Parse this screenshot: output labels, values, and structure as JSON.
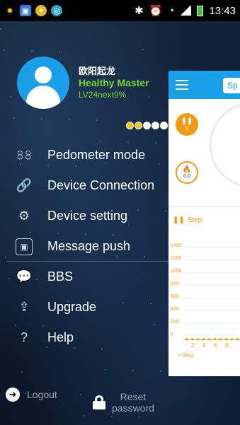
{
  "status_bar": {
    "time": "13:43",
    "icons": [
      "sun-icon",
      "app-icon",
      "chrome-icon",
      "browser-icon",
      "bluetooth-icon",
      "alarm-icon",
      "wifi-icon",
      "signal-icon",
      "battery-icon"
    ]
  },
  "profile": {
    "name": "欧阳起龙",
    "title": "Healthy Master",
    "level": "LV24next9%",
    "progress_dot_colors": [
      "#f0c51c",
      "#f0c51c",
      "#ffffff",
      "#ffffff",
      "#ffffff"
    ]
  },
  "menu": {
    "items": [
      {
        "label": "Pedometer mode",
        "icon": "footprints-icon"
      },
      {
        "label": "Device Connection",
        "icon": "link-icon"
      },
      {
        "label": "Device setting",
        "icon": "gear-icon"
      },
      {
        "label": "Message push",
        "icon": "message-push-icon"
      },
      {
        "label": "BBS",
        "icon": "chat-bubble-icon"
      },
      {
        "label": "Upgrade",
        "icon": "upload-icon"
      },
      {
        "label": "Help",
        "icon": "question-icon"
      }
    ]
  },
  "bottom": {
    "logout_label": "Logout",
    "reset_label_1": "Reset",
    "reset_label_2": "password"
  },
  "main_panel": {
    "tab_label": "Sp",
    "steps_value": "0",
    "calories_value": "0.0",
    "step_header": "Step",
    "y_axis_ticks": [
      "1400",
      "1200",
      "1000",
      "800",
      "600",
      "400",
      "200",
      "0"
    ],
    "x_axis_ticks": [
      "2",
      "4",
      "6",
      "8"
    ],
    "legend": "• Step"
  },
  "colors": {
    "accent_blue": "#1aa0e8",
    "accent_green": "#7bd43a",
    "accent_orange": "#f39a12"
  }
}
